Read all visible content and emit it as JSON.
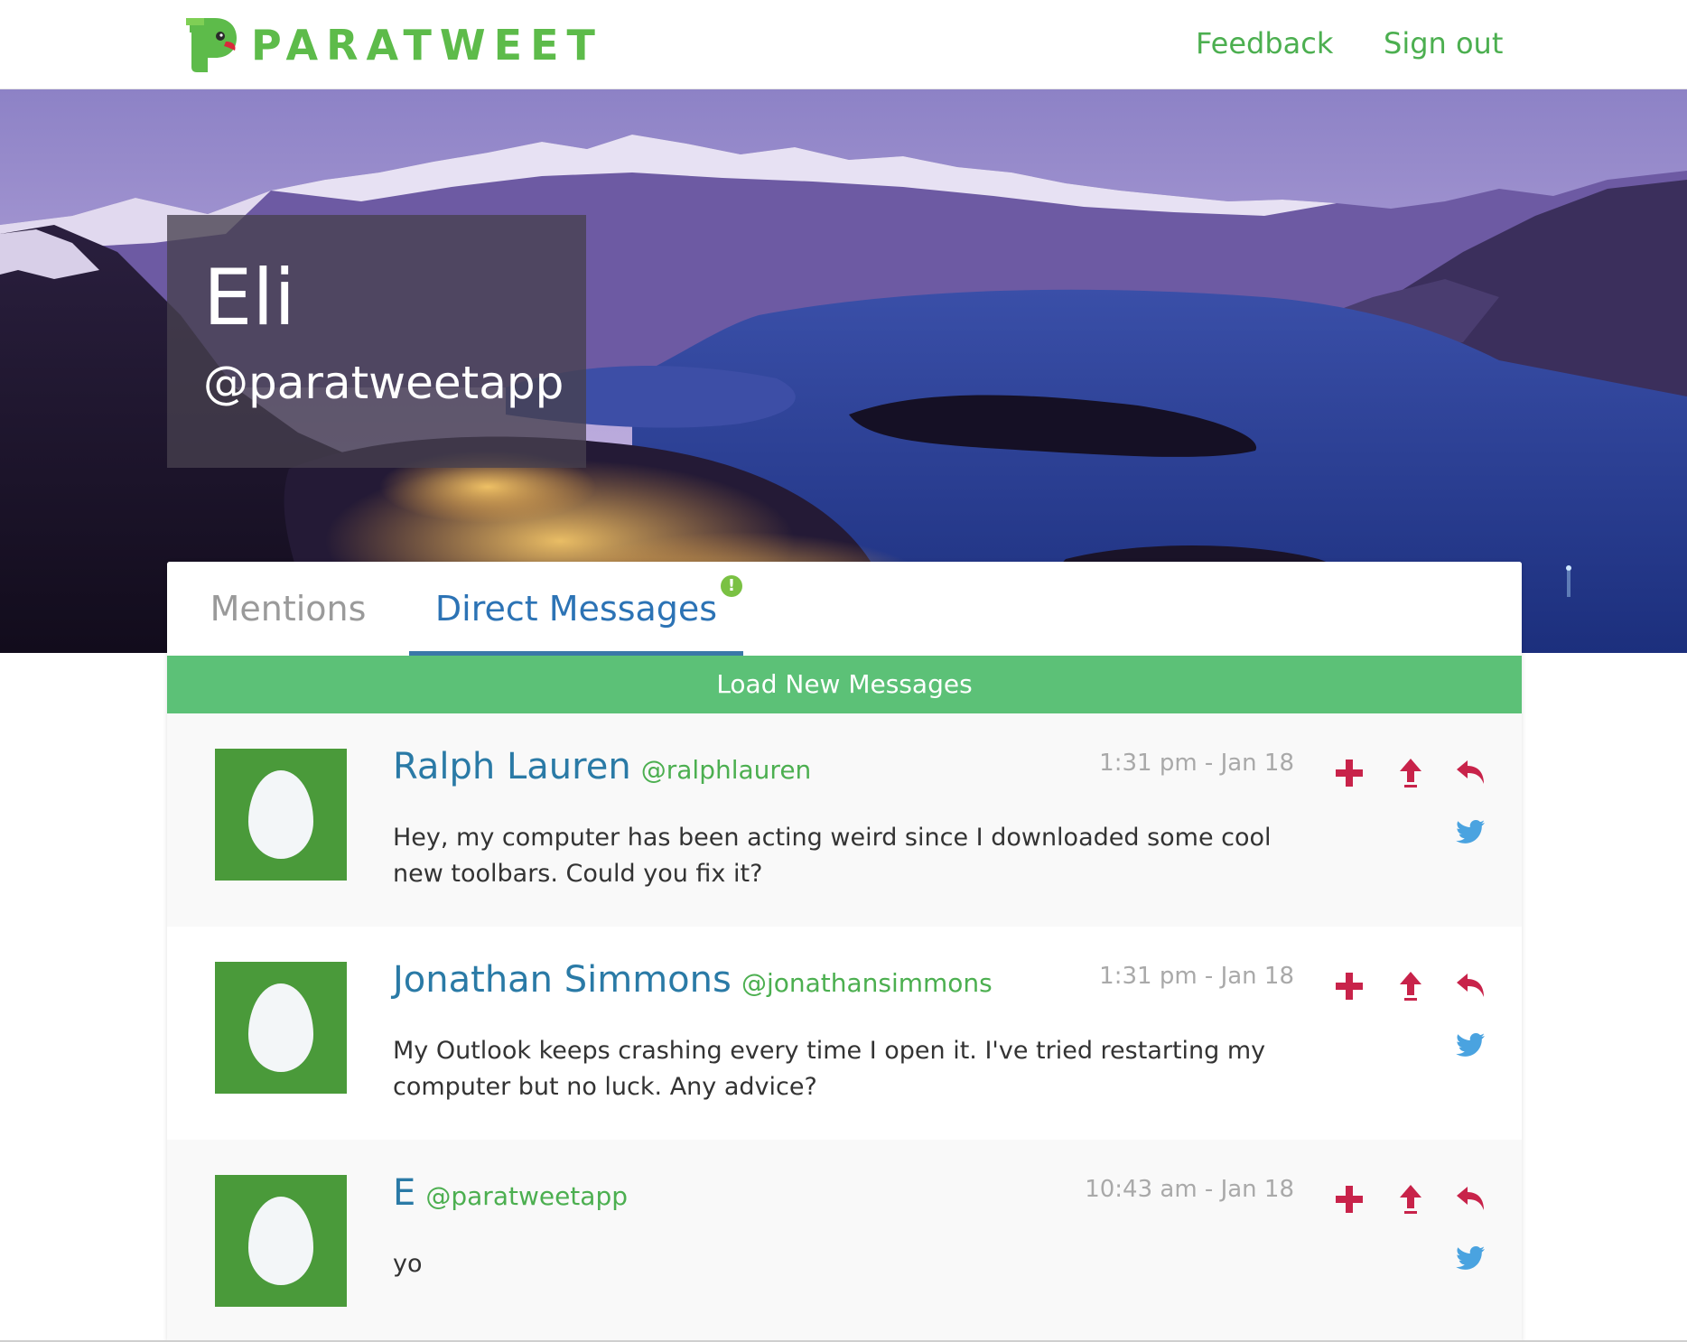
{
  "app": {
    "brand_name": "PARATWEET",
    "brand_color": "#5dbb4a",
    "accent_color": "#2c73b5",
    "action_color": "#c8234a",
    "twitter_color": "#4aa3e0"
  },
  "nav": {
    "feedback_label": "Feedback",
    "signout_label": "Sign out"
  },
  "profile": {
    "name": "Eli",
    "handle": "@paratweetapp"
  },
  "tabs": {
    "mentions_label": "Mentions",
    "dm_label": "Direct Messages",
    "active": "Direct Messages",
    "dm_alert_glyph": "!"
  },
  "load_bar": {
    "label": "Load New Messages"
  },
  "messages": [
    {
      "name": "Ralph Lauren",
      "handle": "@ralphlauren",
      "time": "1:31 pm - Jan 18",
      "body": "Hey, my computer has been acting weird since I downloaded some cool new toolbars. Could you fix it?",
      "avatar_icon": "egg-avatar-icon"
    },
    {
      "name": "Jonathan Simmons",
      "handle": "@jonathansimmons",
      "time": "1:31 pm - Jan 18",
      "body": "My Outlook keeps crashing every time I open it. I've tried restarting my computer but no luck. Any advice?",
      "avatar_icon": "egg-avatar-icon"
    },
    {
      "name": "E",
      "handle": "@paratweetapp",
      "time": "10:43 am - Jan 18",
      "body": "yo",
      "avatar_icon": "egg-avatar-icon"
    }
  ],
  "icons": {
    "add": "plus-icon",
    "escalate": "arrow-up-icon",
    "reply": "reply-icon",
    "twitter": "twitter-bird-icon",
    "logo": "parrot-logo-icon"
  }
}
